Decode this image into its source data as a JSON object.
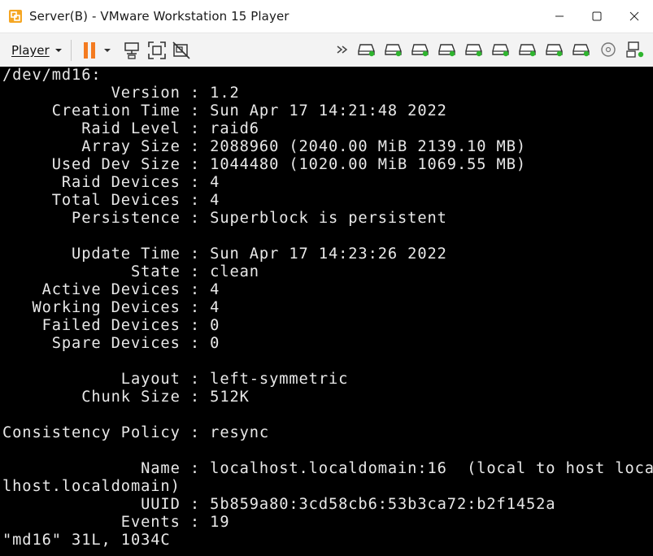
{
  "window": {
    "title": "Server(B) - VMware Workstation 15 Player"
  },
  "toolbar": {
    "player_label": "Player"
  },
  "terminal": {
    "lines": [
      "/dev/md16:",
      "           Version : 1.2",
      "     Creation Time : Sun Apr 17 14:21:48 2022",
      "        Raid Level : raid6",
      "        Array Size : 2088960 (2040.00 MiB 2139.10 MB)",
      "     Used Dev Size : 1044480 (1020.00 MiB 1069.55 MB)",
      "      Raid Devices : 4",
      "     Total Devices : 4",
      "       Persistence : Superblock is persistent",
      "",
      "       Update Time : Sun Apr 17 14:23:26 2022",
      "             State : clean",
      "    Active Devices : 4",
      "   Working Devices : 4",
      "    Failed Devices : 0",
      "     Spare Devices : 0",
      "",
      "            Layout : left-symmetric",
      "        Chunk Size : 512K",
      "",
      "Consistency Policy : resync",
      "",
      "              Name : localhost.localdomain:16  (local to host loca",
      "lhost.localdomain)",
      "              UUID : 5b859a80:3cd58cb6:53b3ca72:b2f1452a",
      "            Events : 19",
      "\"md16\" 31L, 1034C"
    ]
  }
}
